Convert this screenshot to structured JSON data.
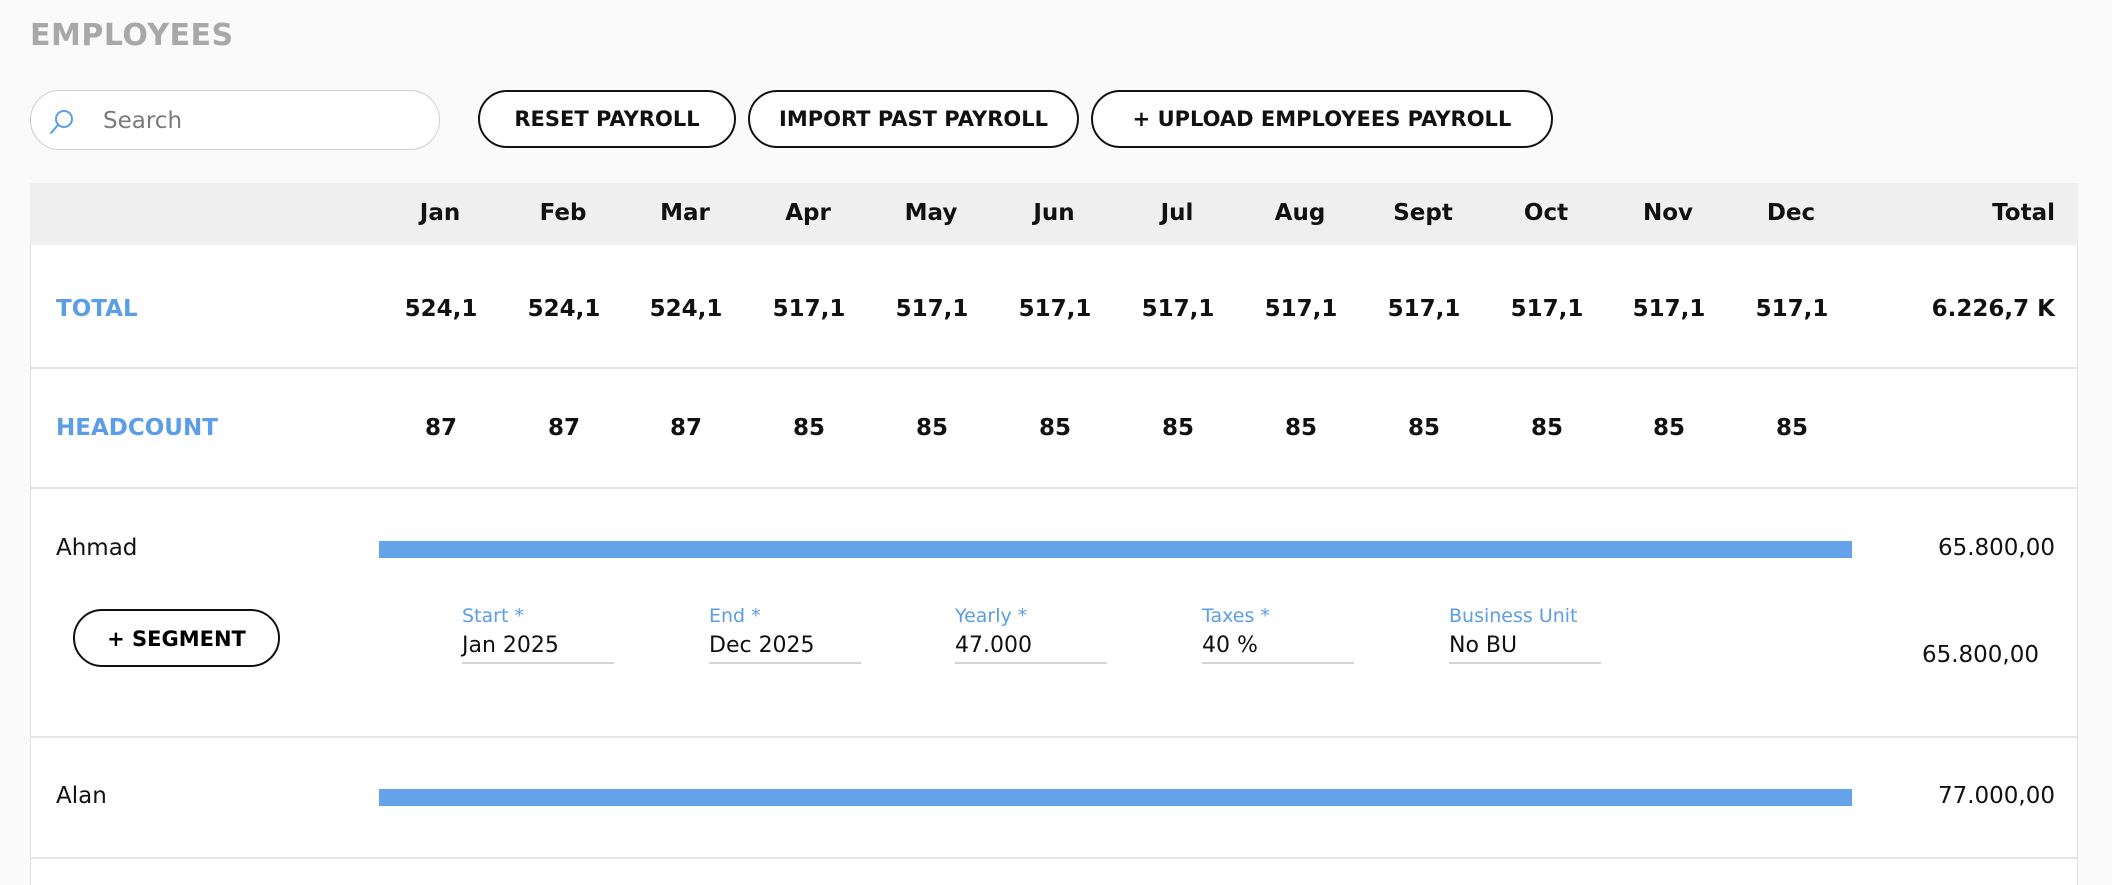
{
  "page_title": "EMPLOYEES",
  "search": {
    "placeholder": "Search",
    "value": ""
  },
  "toolbar": {
    "reset_label": "RESET PAYROLL",
    "import_label": "IMPORT PAST PAYROLL",
    "upload_label": "+ UPLOAD EMPLOYEES PAYROLL"
  },
  "table": {
    "months": [
      "Jan",
      "Feb",
      "Mar",
      "Apr",
      "May",
      "Jun",
      "Jul",
      "Aug",
      "Sept",
      "Oct",
      "Nov",
      "Dec"
    ],
    "total_header": "Total",
    "total_row": {
      "label": "TOTAL",
      "values": [
        "524,1",
        "524,1",
        "524,1",
        "517,1",
        "517,1",
        "517,1",
        "517,1",
        "517,1",
        "517,1",
        "517,1",
        "517,1",
        "517,1"
      ],
      "total": "6.226,7 K"
    },
    "headcount_row": {
      "label": "HEADCOUNT",
      "values": [
        "87",
        "87",
        "87",
        "85",
        "85",
        "85",
        "85",
        "85",
        "85",
        "85",
        "85",
        "85"
      ]
    },
    "employees": [
      {
        "name": "Ahmad",
        "amount": "65.800,00",
        "segment_button": "+ SEGMENT",
        "segment": {
          "start_label": "Start *",
          "start_value": "Jan 2025",
          "end_label": "End *",
          "end_value": "Dec 2025",
          "yearly_label": "Yearly *",
          "yearly_value": "47.000",
          "taxes_label": "Taxes *",
          "taxes_value": "40 %",
          "bu_label": "Business Unit",
          "bu_value": "No BU",
          "amount": "65.800,00"
        }
      },
      {
        "name": "Alan",
        "amount": "77.000,00"
      }
    ]
  },
  "colors": {
    "accent": "#5b9de6",
    "bar": "#64a3ea",
    "title_gray": "#a8a8a8"
  },
  "icons": {
    "search": "search-icon"
  }
}
